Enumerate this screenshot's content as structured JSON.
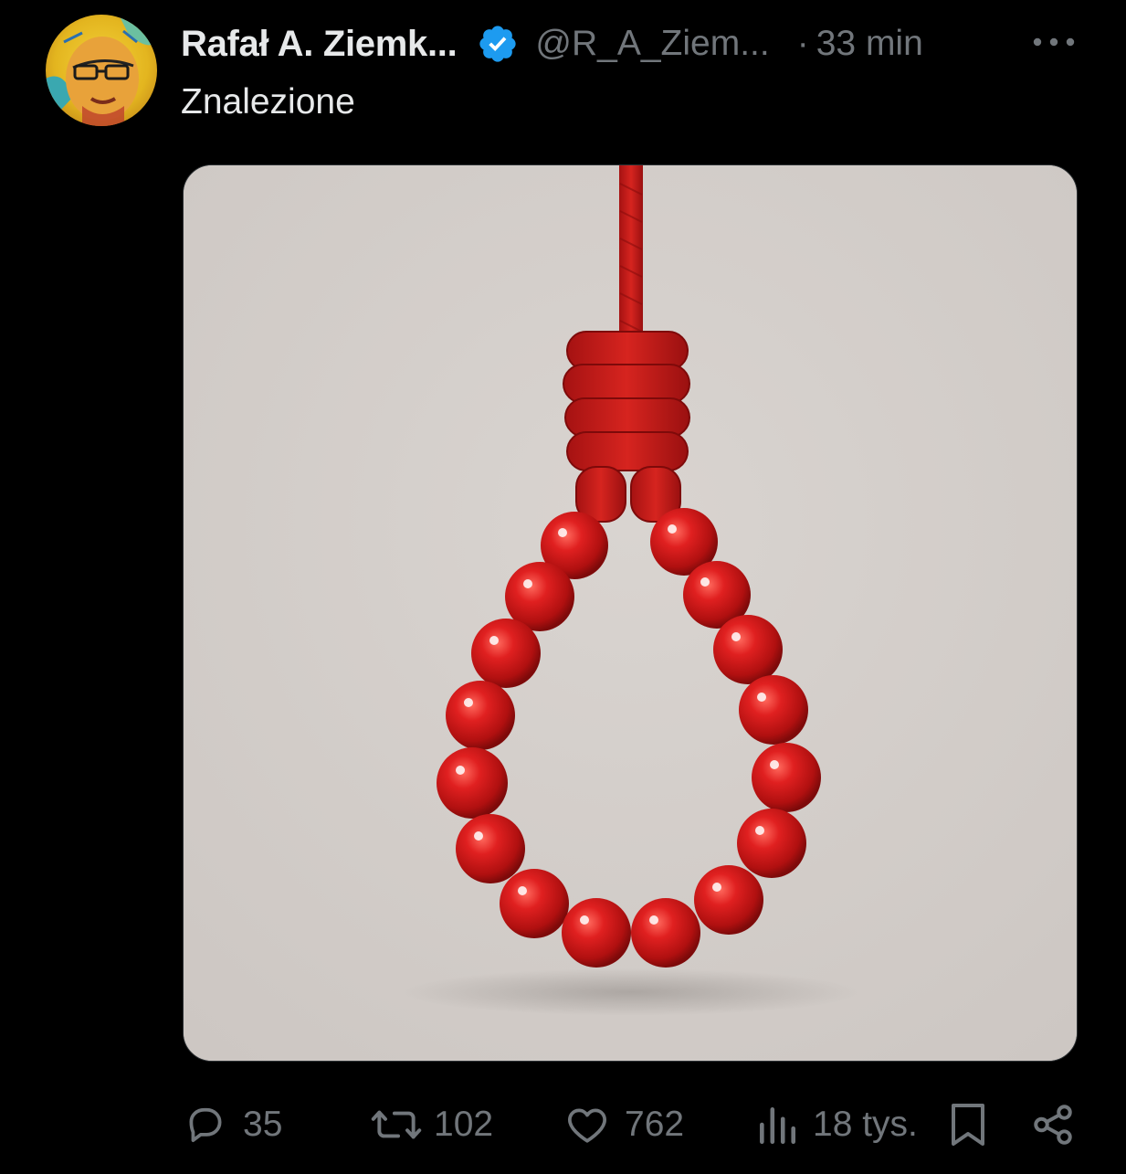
{
  "tweet": {
    "author": {
      "display_name": "Rafał A. Ziemk...",
      "handle": "@R_A_Ziem...",
      "verified": true
    },
    "separator": "·",
    "time": "33 min",
    "text": "Znalezione"
  },
  "actions": {
    "reply_count": "35",
    "retweet_count": "102",
    "like_count": "762",
    "views_count": "18 tys."
  },
  "colors": {
    "background": "#000000",
    "primary_text": "#e7e9ea",
    "secondary_text": "#71767b",
    "verified_blue": "#1d9bf0",
    "bead_red": "#d21a1a",
    "image_background": "#d5d0cc"
  },
  "icons": {
    "reply": "reply-icon",
    "retweet": "retweet-icon",
    "like": "heart-icon",
    "views": "views-icon",
    "bookmark": "bookmark-icon",
    "share": "share-icon",
    "more": "more-icon",
    "verified": "verified-badge-icon"
  }
}
